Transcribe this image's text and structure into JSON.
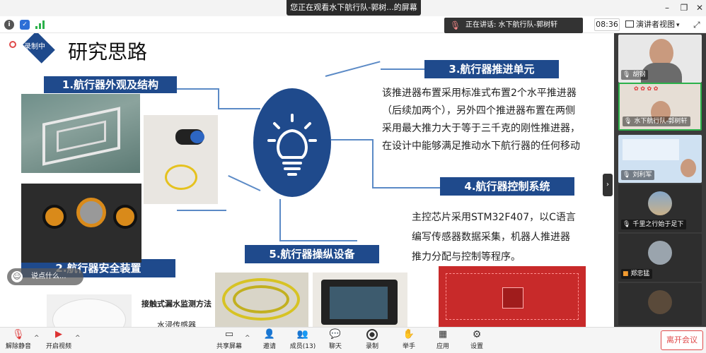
{
  "window": {
    "banner": "您正在观看水下航行队-郭树...的屏幕"
  },
  "toolbar": {
    "speaker": "正在讲话: 水下航行队-郭树轩",
    "clock": "08:36",
    "view_mode": "演讲者视图"
  },
  "slide": {
    "recording": "录制中",
    "title": "研究思路",
    "s1": "1.航行器外观及结构",
    "s2": "2.航行器安全装置",
    "s3": "3.航行器推进单元",
    "s4": "4.航行器控制系统",
    "s5": "5.航行器操纵设备",
    "s3_text": [
      "该推进器布置采用标准式布置2个水平推进器",
      "（后续加两个），另外四个推进器布置在两侧",
      "采用最大推力大于等于三千克的刚性推进器，",
      "在设计中能够满足推动水下航行器的任何移动"
    ],
    "s4_text": [
      "主控芯片采用STM32F407，以C语言",
      "编写传感器数据采集，机器人推进器",
      "推力分配与控制等程序。"
    ],
    "leak_title": "接触式漏水监测方法",
    "leak_sub": "水浸传感器"
  },
  "chat": {
    "placeholder": "说点什么..."
  },
  "participants": [
    {
      "name": "胡钢"
    },
    {
      "name": "水下航行队-郭树轩"
    },
    {
      "name": "刘利军"
    },
    {
      "name": "千里之行始于足下"
    },
    {
      "name": "郑忠猛"
    },
    {
      "name": ""
    }
  ],
  "bottom": {
    "mute": "解除静音",
    "video": "开启视频",
    "share": "共享屏幕",
    "invite": "邀请",
    "members": "成员(13)",
    "chat": "聊天",
    "record": "录制",
    "raise": "举手",
    "apps": "应用",
    "settings": "设置",
    "leave": "离开会议"
  },
  "colors": {
    "slide_blue": "#1f4a8c",
    "line_blue": "#5b8ac6",
    "leave_red": "#e04a4a"
  }
}
